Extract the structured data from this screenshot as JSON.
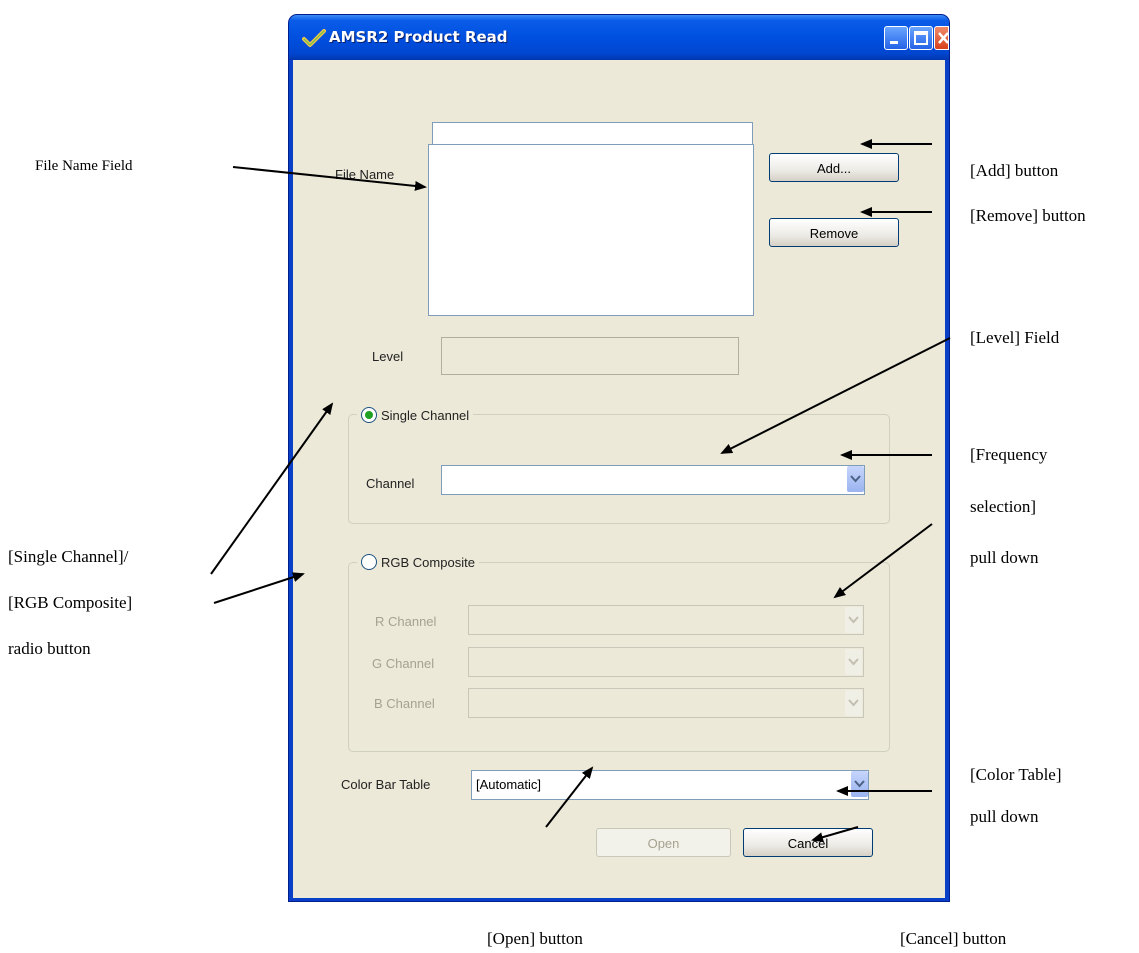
{
  "window": {
    "title": "AMSR2 Product Read",
    "icon": "app-check-icon",
    "controls": [
      "minimize-icon",
      "maximize-icon",
      "close-icon"
    ]
  },
  "dialog": {
    "file_name_label": "File Name",
    "file_name_value": "",
    "add_button": "Add...",
    "remove_button": "Remove",
    "level_label": "Level",
    "level_value": "",
    "single_channel": {
      "radio_label": "Single Channel",
      "selected": true,
      "channel_label": "Channel",
      "channel_value": ""
    },
    "rgb_composite": {
      "radio_label": "RGB Composite",
      "selected": false,
      "r_label": "R Channel",
      "g_label": "G Channel",
      "b_label": "B Channel"
    },
    "color_bar_label": "Color Bar Table",
    "color_bar_value": "[Automatic]",
    "open_button": "Open",
    "cancel_button": "Cancel"
  },
  "annotations": {
    "file_name_field": "File Name Field",
    "add_button": "[Add] button",
    "remove_button": "[Remove] button",
    "level_field": "[Level] Field",
    "frequency_1": "[Frequency",
    "frequency_2": "selection]",
    "frequency_3": "pull down",
    "radio_1": "[Single Channel]/",
    "radio_2": "[RGB Composite]",
    "radio_3": "radio button",
    "color_table_1": "[Color Table]",
    "color_table_2": "pull down",
    "open_button": "[Open] button",
    "cancel_button": "[Cancel] button"
  },
  "colors": {
    "title_bar": "#0a5ce8",
    "dialog_bg": "#ece9d8",
    "radio_dot": "#21a121"
  }
}
